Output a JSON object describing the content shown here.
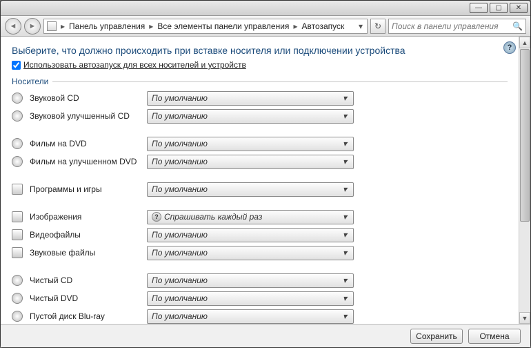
{
  "window": {
    "min": "—",
    "max": "▢",
    "close": "✕"
  },
  "nav": {
    "back": "◄",
    "fwd": "►",
    "crumbs": [
      "Панель управления",
      "Все элементы панели управления",
      "Автозапуск"
    ],
    "dropdown": "▾",
    "refresh": "↻"
  },
  "search": {
    "placeholder": "Поиск в панели управления",
    "icon": "🔍"
  },
  "page": {
    "heading": "Выберите, что должно происходить при вставке носителя или подключении устройства",
    "checkbox_label": "Использовать автозапуск для всех носителей и устройств",
    "checkbox_checked": true,
    "group_label": "Носители",
    "help": "?"
  },
  "default_option": "По умолчанию",
  "ask_option": "Спрашивать каждый раз",
  "rows": [
    {
      "icon": "disc",
      "label": "Звуковой CD",
      "value_key": "default_option"
    },
    {
      "icon": "disc",
      "label": "Звуковой улучшенный CD",
      "value_key": "default_option"
    },
    {
      "spacer": true
    },
    {
      "icon": "disc",
      "label": "Фильм на DVD",
      "value_key": "default_option"
    },
    {
      "icon": "disc",
      "label": "Фильм на улучшенном DVD",
      "value_key": "default_option"
    },
    {
      "spacer": true
    },
    {
      "icon": "sq",
      "label": "Программы и игры",
      "value_key": "default_option"
    },
    {
      "spacer": true
    },
    {
      "icon": "sq",
      "label": "Изображения",
      "value_key": "ask_option",
      "has_icon": true
    },
    {
      "icon": "sq",
      "label": "Видеофайлы",
      "value_key": "default_option"
    },
    {
      "icon": "sq",
      "label": "Звуковые файлы",
      "value_key": "default_option"
    },
    {
      "spacer": true
    },
    {
      "icon": "disc",
      "label": "Чистый CD",
      "value_key": "default_option"
    },
    {
      "icon": "disc",
      "label": "Чистый DVD",
      "value_key": "default_option"
    },
    {
      "icon": "disc",
      "label": "Пустой диск Blu-ray",
      "value_key": "default_option"
    }
  ],
  "footer": {
    "save": "Сохранить",
    "cancel": "Отмена"
  }
}
